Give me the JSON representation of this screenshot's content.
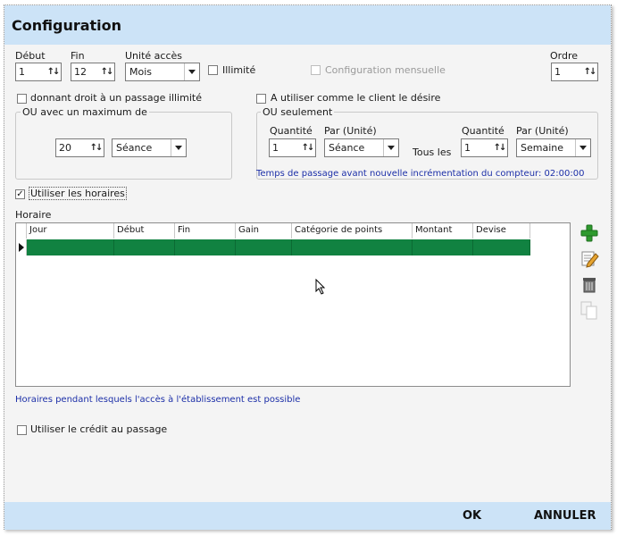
{
  "window": {
    "title": "Configuration"
  },
  "top_row": {
    "debut": {
      "label": "Début",
      "value": "1"
    },
    "fin": {
      "label": "Fin",
      "value": "12"
    },
    "unite": {
      "label": "Unité accès",
      "value": "Mois"
    },
    "illimite": {
      "label": "Illimité",
      "checked": false
    },
    "config_mensuelle": {
      "label": "Configuration mensuelle",
      "checked": false,
      "disabled": true
    },
    "ordre": {
      "label": "Ordre",
      "value": "1"
    }
  },
  "left_group": {
    "checkbox_label": "donnant droit à un passage illimité",
    "legend": "OU avec un maximum de",
    "quantity": "20",
    "unit": "Séance"
  },
  "right_group": {
    "checkbox_label": "A utiliser comme le client le désire",
    "legend": "OU seulement",
    "qty1_label": "Quantité",
    "qty1_value": "1",
    "unit1_label": "Par (Unité)",
    "unit1_value": "Séance",
    "tous_les": "Tous les",
    "qty2_label": "Quantité",
    "qty2_value": "1",
    "unit2_label": "Par (Unité)",
    "unit2_value": "Semaine",
    "info": "Temps de passage avant nouvelle incrémentation du compteur: 02:00:00"
  },
  "horaires": {
    "use_label": "Utiliser les horaires",
    "use_checked": true,
    "section_label": "Horaire",
    "columns": [
      "Jour",
      "Début",
      "Fin",
      "Gain",
      "Catégorie de points",
      "Montant",
      "Devise"
    ],
    "info": "Horaires pendant lesquels l'accès à l'établissement est possible"
  },
  "credit": {
    "label": "Utiliser le crédit au passage",
    "checked": false
  },
  "footer": {
    "ok": "OK",
    "cancel": "ANNULER"
  },
  "colors": {
    "title_bar": "#cce3f7",
    "row_selected": "#118241",
    "info_text": "#1c2fa8"
  },
  "toolbar_icons": [
    "add-icon",
    "edit-icon",
    "delete-icon",
    "copy-icon"
  ]
}
